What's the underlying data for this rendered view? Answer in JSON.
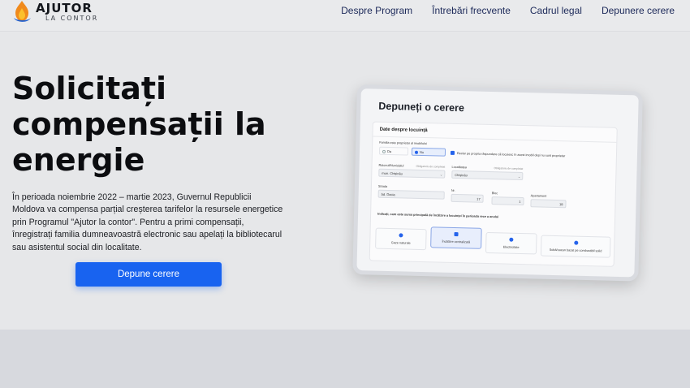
{
  "brand": {
    "title": "AJUTOR",
    "subtitle": "LA CONTOR",
    "icon": "flame-drop-logo"
  },
  "nav": {
    "items": [
      {
        "label": "Despre Program"
      },
      {
        "label": "Întrebări frecvente"
      },
      {
        "label": "Cadrul legal"
      },
      {
        "label": "Depunere cerere"
      }
    ]
  },
  "hero": {
    "title": "Solicitați compensații la energie",
    "description": "În perioada noiembrie 2022 – martie 2023, Guvernul Republicii Moldova va compensa parțial creșterea tarifelor la resursele energetice prin Programul \"Ajutor la contor\". Pentru a primi compensații, înregistrați familia dumneavoastră electronic sau apelați la bibliotecarul sau asistentul social din localitate.",
    "cta_label": "Depune cerere"
  },
  "tablet": {
    "title": "Depuneți o cerere",
    "section_title": "Date despre locuință",
    "owner_question": "Familia este proprietar al imobilului",
    "owner_yes": "Da",
    "owner_no": "Nu",
    "declaration": "Declar pe propria răspundere că locuiesc în acest imobil deși nu sunt proprietar",
    "district_label": "Raionul/Municipiul",
    "district_hint": "Obligatoriu de completat",
    "district_value": "mun. Chișinău",
    "locality_label": "Localitatea",
    "locality_hint": "Obligatoriu de completat",
    "locality_value": "Chișinău",
    "street_label": "Strada",
    "street_value": "bd. Dacia",
    "number_label": "Nr.",
    "number_value": "17",
    "block_label": "Bloc",
    "block_value": "1",
    "apartment_label": "Apartament",
    "apartment_value": "18",
    "heating_question": "Indicați, care este sursa principală de încălzire a locuinței în perioada rece a anului",
    "heating_options": [
      "Gaze naturale",
      "Încălzire centralizată",
      "Electricitate",
      "Sobă/cazan bazat pe combustibil solid"
    ],
    "heating_selected": "Încălzire centralizată"
  },
  "colors": {
    "accent": "#1863f0",
    "page_bg": "#e6e7e9",
    "nav_text": "#1d2a5a"
  }
}
